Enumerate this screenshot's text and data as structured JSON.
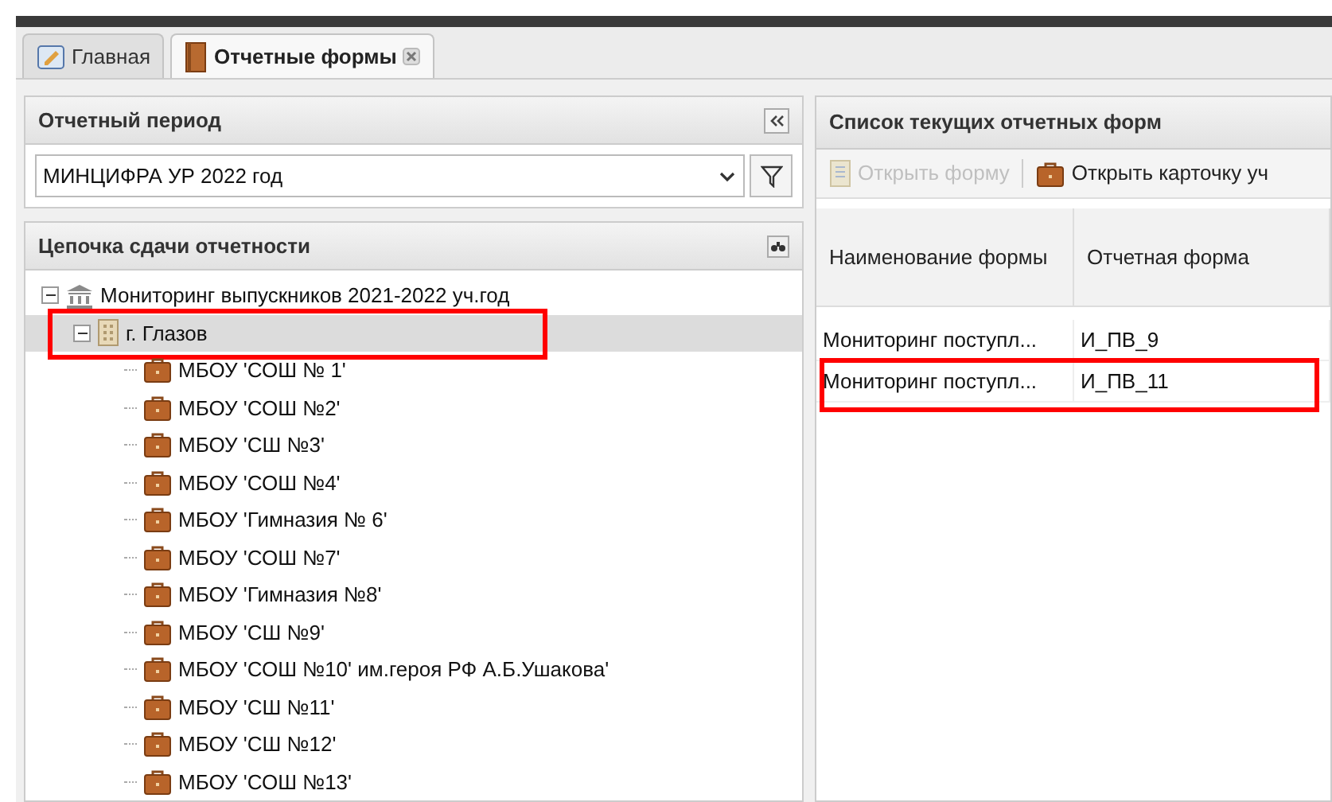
{
  "tabs": [
    {
      "label": "Главная",
      "selected": false,
      "closable": false
    },
    {
      "label": "Отчетные формы",
      "selected": true,
      "closable": true
    }
  ],
  "period_panel": {
    "title": "Отчетный период",
    "field": {
      "value": "МИНЦИФРА УР 2022 год"
    }
  },
  "chain_panel": {
    "title": "Цепочка сдачи отчетности",
    "tree": [
      {
        "label": "Мониторинг выпускников 2021-2022 уч.год",
        "kind": "root",
        "expanded": true,
        "selected": false,
        "highlighted": false,
        "children": [
          {
            "label": "г. Глазов",
            "kind": "city",
            "expanded": true,
            "selected": true,
            "highlighted": true,
            "children": [
              {
                "label": "МБОУ 'СОШ № 1'",
                "kind": "school",
                "selected": false,
                "highlighted": false
              },
              {
                "label": "МБОУ 'СОШ №2'",
                "kind": "school",
                "selected": false,
                "highlighted": false
              },
              {
                "label": "МБОУ 'СШ №3'",
                "kind": "school",
                "selected": false,
                "highlighted": false
              },
              {
                "label": "МБОУ 'СОШ №4'",
                "kind": "school",
                "selected": false,
                "highlighted": false
              },
              {
                "label": "МБОУ 'Гимназия № 6'",
                "kind": "school",
                "selected": false,
                "highlighted": false
              },
              {
                "label": "МБОУ 'СОШ №7'",
                "kind": "school",
                "selected": false,
                "highlighted": false
              },
              {
                "label": "МБОУ 'Гимназия №8'",
                "kind": "school",
                "selected": false,
                "highlighted": false
              },
              {
                "label": "МБОУ 'СШ №9'",
                "kind": "school",
                "selected": false,
                "highlighted": false
              },
              {
                "label": "МБОУ 'СОШ №10' им.героя РФ А.Б.Ушакова'",
                "kind": "school",
                "selected": false,
                "highlighted": false
              },
              {
                "label": "МБОУ 'СШ №11'",
                "kind": "school",
                "selected": false,
                "highlighted": false
              },
              {
                "label": "МБОУ 'СШ №12'",
                "kind": "school",
                "selected": false,
                "highlighted": false
              },
              {
                "label": "МБОУ 'СОШ №13'",
                "kind": "school",
                "selected": false,
                "highlighted": false
              }
            ]
          }
        ]
      }
    ]
  },
  "forms_panel": {
    "title": "Список текущих отчетных форм",
    "toolbar": [
      {
        "label": "Открыть форму",
        "disabled": true
      },
      {
        "label": "Открыть карточку уч",
        "disabled": false
      }
    ],
    "columns": [
      "Наименование формы",
      "Отчетная форма"
    ],
    "rows": [
      {
        "cells": [
          "Мониторинг поступл...",
          "И_ПВ_9"
        ],
        "highlighted": false
      },
      {
        "cells": [
          "Мониторинг поступл...",
          "И_ПВ_11"
        ],
        "highlighted": true
      }
    ]
  }
}
